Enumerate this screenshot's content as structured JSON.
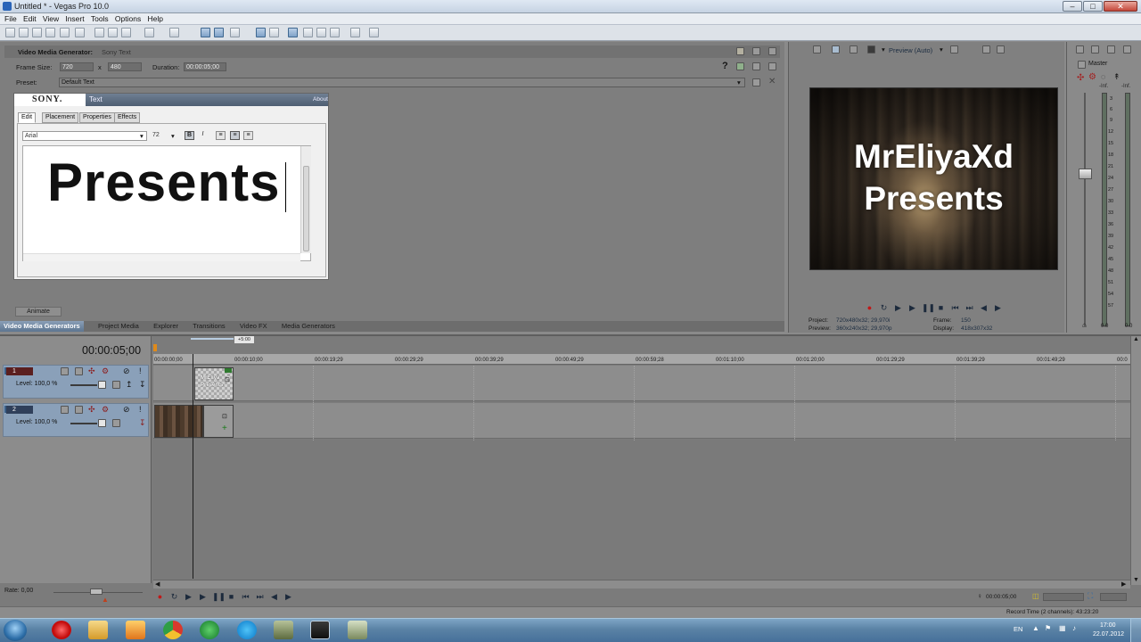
{
  "window": {
    "title": "Untitled * - Vegas Pro 10.0"
  },
  "menu": [
    "File",
    "Edit",
    "View",
    "Insert",
    "Tools",
    "Options",
    "Help"
  ],
  "generator": {
    "header_label": "Video Media Generator:",
    "header_value": "Sony Text",
    "frame_size_label": "Frame Size:",
    "frame_width": "720",
    "frame_x": "x",
    "frame_height": "480",
    "duration_label": "Duration:",
    "duration": "00:00:05;00",
    "preset_label": "Preset:",
    "preset_value": "Default Text",
    "help_glyph": "?"
  },
  "plugin": {
    "brand": "SONY.",
    "title": "Text",
    "about": "About",
    "tabs": [
      "Edit",
      "Placement",
      "Properties",
      "Effects"
    ],
    "font": "Arial",
    "size": "72",
    "bold": "B",
    "italic": "I",
    "text": "Presents"
  },
  "animate_button": "Animate",
  "bottom_tabs": [
    "Video Media Generators",
    "Project Media",
    "Explorer",
    "Transitions",
    "Video FX",
    "Media Generators"
  ],
  "preview": {
    "mode": "Preview (Auto)",
    "lines": [
      "MrEliyaXd",
      "Presents"
    ],
    "project_label": "Project:",
    "project_value": "720x480x32; 29,970i",
    "preview_label": "Preview:",
    "preview_value": "360x240x32; 29,970p",
    "frame_label": "Frame:",
    "frame_value": "150",
    "display_label": "Display:",
    "display_value": "418x307x32"
  },
  "master": {
    "label": "Master",
    "inf": "-Inf.",
    "scale": [
      "3",
      "6",
      "9",
      "12",
      "15",
      "18",
      "21",
      "24",
      "27",
      "30",
      "33",
      "36",
      "39",
      "42",
      "45",
      "48",
      "51",
      "54",
      "57"
    ],
    "readout_left": "0.0",
    "readout_right": "0.0"
  },
  "timeline": {
    "timecode": "00:00:05;00",
    "cursor_flag": "+5:00",
    "ruler": [
      "00:00:00;00",
      "00:00:10;00",
      "00:00:19;29",
      "00:00:29;29",
      "00:00:39;29",
      "00:00:49;29",
      "00:00:59;28",
      "00:01:10;00",
      "00:01:20;00",
      "00:01:29;29",
      "00:01:39;29",
      "00:01:49;29",
      "00:0"
    ],
    "tracks": [
      {
        "number": "1",
        "level": "Level: 100,0 %"
      },
      {
        "number": "2",
        "level": "Level: 100,0 %"
      }
    ],
    "clip_text": [
      "MrEliya",
      "Presents"
    ],
    "rate": "Rate: 0,00",
    "transport_time": "00:00:05;00",
    "record_time": "Record Time (2 channels): 43:23:20"
  },
  "taskbar": {
    "lang": "EN",
    "time": "17:00",
    "date": "22.07.2012"
  }
}
